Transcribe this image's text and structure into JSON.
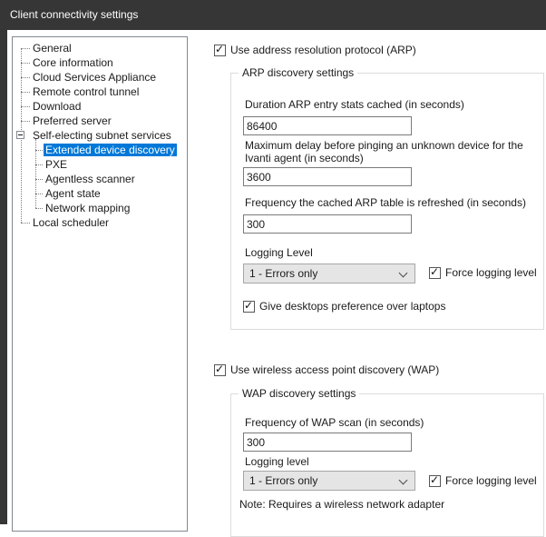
{
  "window": {
    "title": "Client connectivity settings"
  },
  "colors": {
    "titlebar": "#363636",
    "selection": "#0078d7",
    "combobox_bg": "#e5e5e5"
  },
  "tree": {
    "items": [
      {
        "label": "General",
        "level": 0
      },
      {
        "label": "Core information",
        "level": 0
      },
      {
        "label": "Cloud Services Appliance",
        "level": 0
      },
      {
        "label": "Remote control tunnel",
        "level": 0
      },
      {
        "label": "Download",
        "level": 0
      },
      {
        "label": "Preferred server",
        "level": 0
      },
      {
        "label": "Self-electing subnet services",
        "level": 0,
        "expander": "minus"
      },
      {
        "label": "Extended device discovery",
        "level": 1,
        "selected": true
      },
      {
        "label": "PXE",
        "level": 1
      },
      {
        "label": "Agentless scanner",
        "level": 1
      },
      {
        "label": "Agent state",
        "level": 1
      },
      {
        "label": "Network mapping",
        "level": 1
      },
      {
        "label": "Local scheduler",
        "level": 0
      }
    ]
  },
  "arp": {
    "enable_label": "Use address resolution protocol (ARP)",
    "enable_checked": true,
    "group_title": "ARP discovery settings",
    "duration_label": "Duration ARP entry stats cached (in seconds)",
    "duration_value": "86400",
    "max_delay_label": "Maximum delay before pinging an unknown device for the Ivanti agent (in seconds)",
    "max_delay_value": "3600",
    "refresh_label": "Frequency the cached ARP table is refreshed (in seconds)",
    "refresh_value": "300",
    "logging_label": "Logging Level",
    "logging_value": "1 - Errors only",
    "force_logging_label": "Force logging level",
    "force_logging_checked": true,
    "desktops_label": "Give desktops preference over laptops",
    "desktops_checked": true
  },
  "wap": {
    "enable_label": "Use wireless access point discovery (WAP)",
    "enable_checked": true,
    "group_title": "WAP discovery settings",
    "frequency_label": "Frequency of WAP scan (in seconds)",
    "frequency_value": "300",
    "logging_label": "Logging level",
    "logging_value": "1 - Errors only",
    "force_logging_label": "Force logging level",
    "force_logging_checked": true,
    "note": "Note: Requires a wireless network adapter"
  }
}
